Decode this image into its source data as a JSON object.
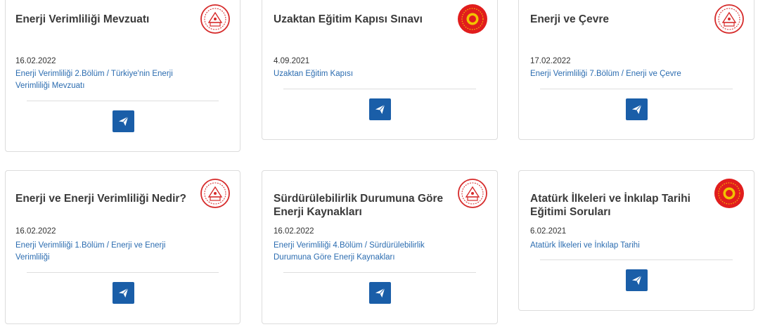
{
  "cards": [
    {
      "title": "Enerji Verimliliği Mevzuatı",
      "date": "16.02.2022",
      "link": "Enerji Verimliliği 2.Bölüm / Türkiye'nin Enerji Verimliliği Mevzuatı",
      "logo": "meb-emblem-icon"
    },
    {
      "title": "Uzaktan Eğitim Kapısı Sınavı",
      "date": "4.09.2021",
      "link": "Uzaktan Eğitim Kapısı",
      "logo": "presidency-seal-icon"
    },
    {
      "title": "Enerji ve Çevre",
      "date": "17.02.2022",
      "link": "Enerji Verimliliği 7.Bölüm / Enerji ve Çevre",
      "logo": "meb-emblem-icon"
    },
    {
      "title": "Enerji ve Enerji Verimliliği Nedir?",
      "date": "16.02.2022",
      "link": "Enerji Verimliliği 1.Bölüm / Enerji ve Enerji Verimliliği",
      "logo": "meb-emblem-icon"
    },
    {
      "title": "Sürdürülebilirlik Durumuna Göre Enerji Kaynakları",
      "date": "16.02.2022",
      "link": "Enerji Verimliliği 4.Bölüm / Sürdürülebilirlik Durumuna Göre Enerji Kaynakları",
      "logo": "meb-emblem-icon"
    },
    {
      "title": "Atatürk İlkeleri ve İnkılap Tarihi Eğitimi Soruları",
      "date": "6.02.2021",
      "link": "Atatürk İlkeleri ve İnkılap Tarihi",
      "logo": "presidency-seal-icon"
    }
  ],
  "colors": {
    "accent": "#1a5ea8",
    "link": "#2b6cb0",
    "emblem_red": "#d62a2a",
    "seal_red": "#e11d1d",
    "seal_gold": "#f2c200"
  },
  "icons": {
    "send": "paper-plane-icon"
  }
}
